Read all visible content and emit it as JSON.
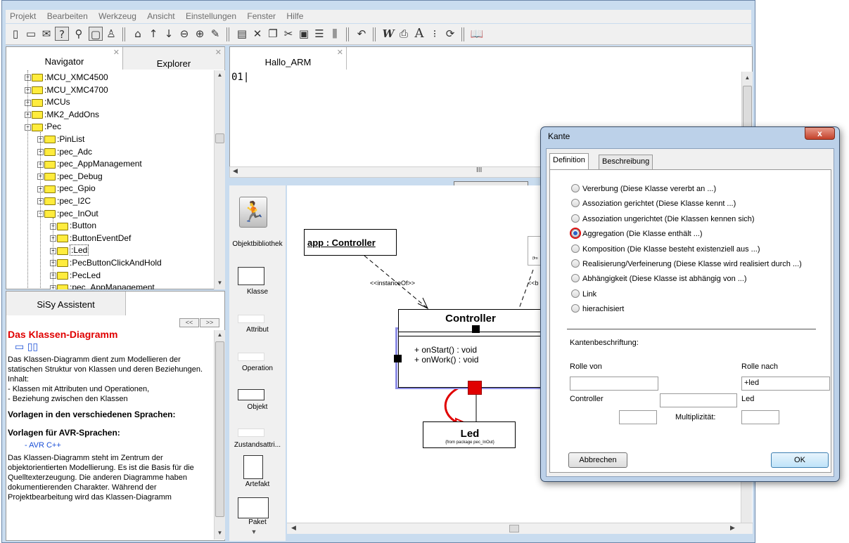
{
  "menu": [
    "Projekt",
    "Bearbeiten",
    "Werkzeug",
    "Ansicht",
    "Einstellungen",
    "Fenster",
    "Hilfe"
  ],
  "nav_tabs": {
    "navigator": "Navigator",
    "explorer": "Explorer"
  },
  "tree": [
    {
      "label": ":MCU_XMC4500",
      "level": 0
    },
    {
      "label": ":MCU_XMC4700",
      "level": 0
    },
    {
      "label": ":MCUs",
      "level": 0
    },
    {
      "label": ":MK2_AddOns",
      "level": 0
    },
    {
      "label": ":Pec",
      "level": 0
    },
    {
      "label": ":PinList",
      "level": 1
    },
    {
      "label": ":pec_Adc",
      "level": 1
    },
    {
      "label": ":pec_AppManagement",
      "level": 1
    },
    {
      "label": ":pec_Debug",
      "level": 1
    },
    {
      "label": ":pec_Gpio",
      "level": 1
    },
    {
      "label": ":pec_I2C",
      "level": 1
    },
    {
      "label": ":pec_InOut",
      "level": 1
    },
    {
      "label": ":Button",
      "level": 2
    },
    {
      "label": ":ButtonEventDef",
      "level": 2
    },
    {
      "label": ":Led",
      "level": 2
    },
    {
      "label": ":PecButtonClickAndHold",
      "level": 2
    },
    {
      "label": ":PecLed",
      "level": 2
    },
    {
      "label": ":pec_AppManagement",
      "level": 2
    }
  ],
  "assistant": {
    "tab": "SiSy Assistent",
    "nav_prev": "<<",
    "nav_next": ">>",
    "title": "Das Klassen-Diagramm",
    "intro": "Das Klassen-Diagramm dient zum Modellieren der statischen Struktur von Klassen und deren Beziehungen.",
    "inhalt_label": "Inhalt:",
    "bullet1": "- Klassen mit Attributen und Operationen,",
    "bullet2": "- Beziehung zwischen den Klassen",
    "heading1": "Vorlagen in den verschiedenen Sprachen:",
    "heading2": "Vorlagen für AVR-Sprachen:",
    "link1": "- AVR C++",
    "outro": "Das Klassen-Diagramm steht im Zentrum der objektorientierten Modellierung. Es ist die Basis für die Quelltexterzeugung. Die anderen Diagramme haben dokumentierenden Charakter. Während der Projektbearbeitung wird das Klassen-Diagramm"
  },
  "editor": {
    "tab": "Hallo_ARM",
    "content": "01|",
    "hscroll_label": "III"
  },
  "palette": [
    "Objektbibliothek",
    "Klasse",
    "Attribut",
    "Operation",
    "Objekt",
    "Zustandsattri...",
    "Artefakt",
    "Paket"
  ],
  "diagram": {
    "object_label": "app : Controller",
    "instance_of": "<<instanceOf>>",
    "instance_of_partial": "<<b",
    "class_name": "Controller",
    "op1": "+ onStart() : void",
    "op2": "+ onWork() : void",
    "led_name": "Led",
    "led_package": "{from package pec_InOut}",
    "partial_from": "{fro"
  },
  "dialog": {
    "title": "Kante",
    "close": "x",
    "tab_definition": "Definition",
    "tab_beschreibung": "Beschreibung",
    "options": [
      {
        "label": "Vererbung  (Diese Klasse vererbt an ...)",
        "selected": false
      },
      {
        "label": "Assoziation gerichtet  (Diese Klasse kennt ...)",
        "selected": false
      },
      {
        "label": "Assoziation ungerichtet  (Die Klassen kennen sich)",
        "selected": false
      },
      {
        "label": "Aggregation  (Die Klasse enthält ...)",
        "selected": true
      },
      {
        "label": "Komposition  (Die Klasse besteht existenziell aus ...)",
        "selected": false
      },
      {
        "label": "Realisierung/Verfeinerung  (Diese Klasse wird realisiert durch ...)",
        "selected": false
      },
      {
        "label": "Abhängigkeit  (Diese Klasse ist abhängig von ...)",
        "selected": false
      },
      {
        "label": "Link",
        "selected": false
      },
      {
        "label": "hierachisiert",
        "selected": false
      }
    ],
    "kanten_label": "Kantenbeschriftung:",
    "rolle_von": "Rolle von",
    "rolle_nach": "Rolle nach",
    "rolle_von_value": "",
    "rolle_nach_value": "+led",
    "from_class": "Controller",
    "to_class": "Led",
    "middle_value": "",
    "mult_from": "",
    "mult_to": "",
    "multiplizitaet": "Multiplizität:",
    "cancel": "Abbrechen",
    "ok": "OK"
  },
  "colors": {
    "accent_red": "#e00000",
    "selection_blue": "#8f8fe6",
    "handle_red": "#e00000",
    "link_blue": "#1a4fd6"
  }
}
